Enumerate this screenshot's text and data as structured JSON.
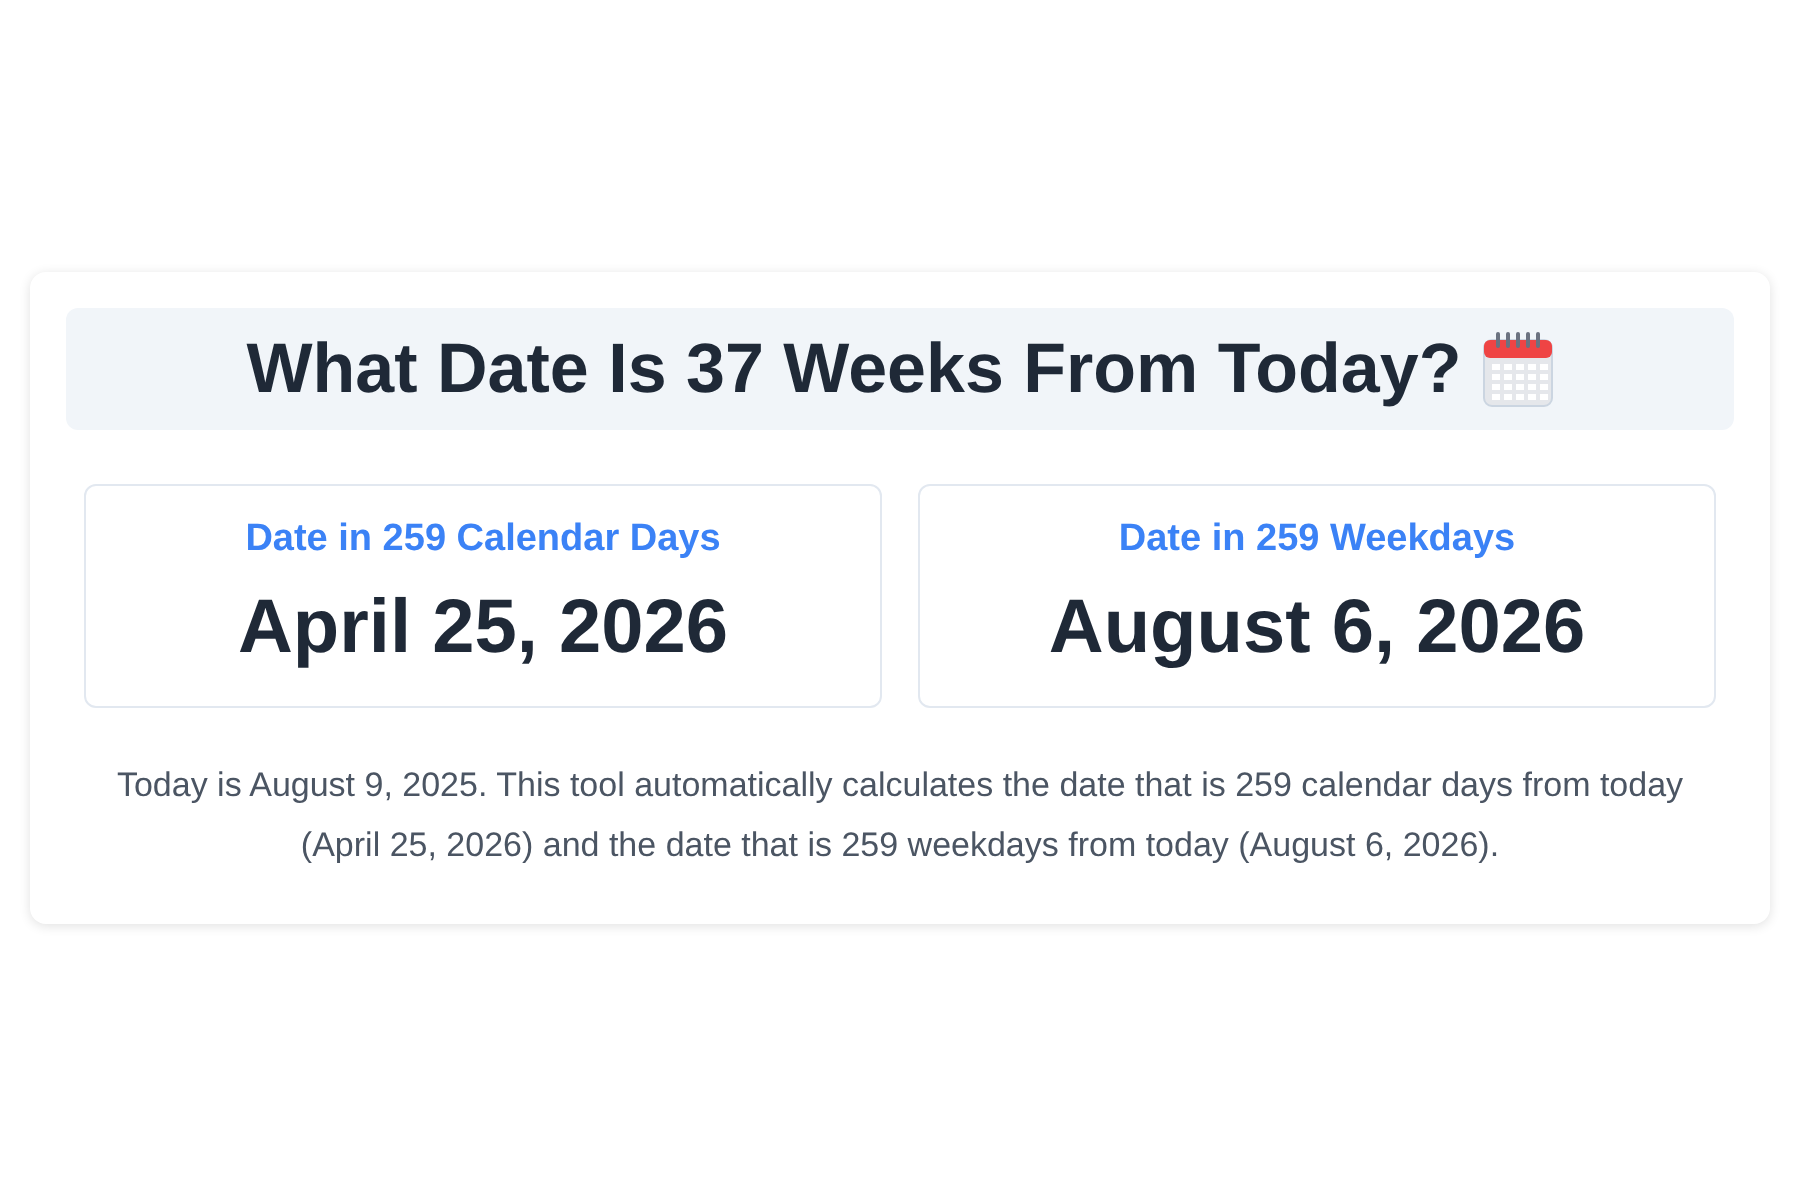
{
  "title": "What Date Is 37 Weeks From Today?",
  "results": [
    {
      "label": "Date in 259 Calendar Days",
      "date": "April 25, 2026"
    },
    {
      "label": "Date in 259 Weekdays",
      "date": "August 6, 2026"
    }
  ],
  "description": "Today is August 9, 2025. This tool automatically calculates the date that is 259 calendar days from today (April 25, 2026) and the date that is 259 weekdays from today (August 6, 2026)."
}
